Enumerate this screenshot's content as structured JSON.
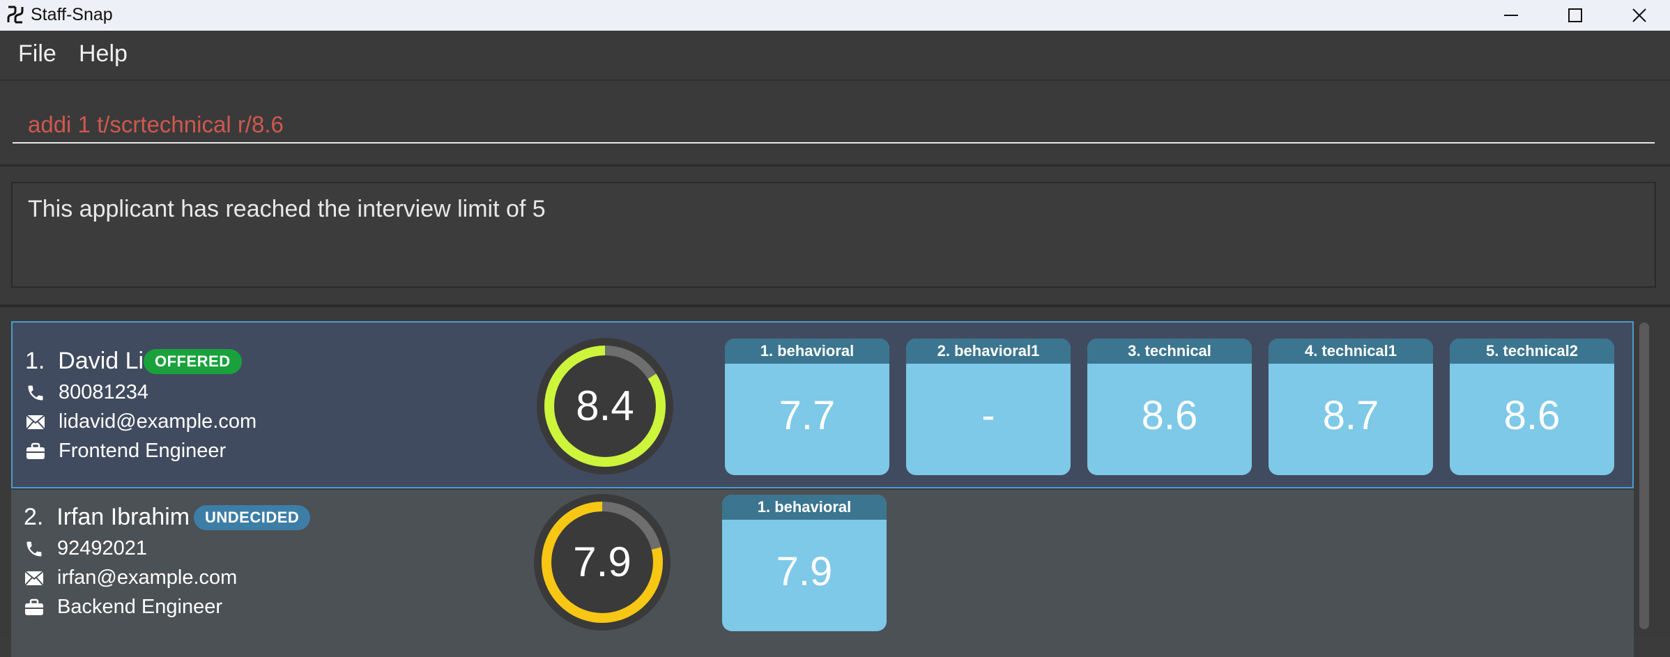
{
  "window": {
    "title": "Staff-Snap"
  },
  "menu": {
    "file": "File",
    "help": "Help"
  },
  "command": {
    "value": "addi 1 t/scrtechnical r/8.6"
  },
  "result": {
    "text": "This applicant has reached the interview limit of 5"
  },
  "applicants": [
    {
      "index": "1.",
      "name": "David Li",
      "status": "OFFERED",
      "phone": "80081234",
      "email": "lidavid@example.com",
      "position": "Frontend Engineer",
      "rating": "8.4",
      "rating_fraction": 0.84,
      "ring_color": "#cdf53b",
      "interviews": [
        {
          "label": "1. behavioral",
          "score": "7.7"
        },
        {
          "label": "2. behavioral1",
          "score": "-"
        },
        {
          "label": "3. technical",
          "score": "8.6"
        },
        {
          "label": "4. technical1",
          "score": "8.7"
        },
        {
          "label": "5. technical2",
          "score": "8.6"
        }
      ]
    },
    {
      "index": "2.",
      "name": "Irfan Ibrahim",
      "status": "UNDECIDED",
      "phone": "92492021",
      "email": "irfan@example.com",
      "position": "Backend Engineer",
      "rating": "7.9",
      "rating_fraction": 0.79,
      "ring_color": "#f7c713",
      "interviews": [
        {
          "label": "1. behavioral",
          "score": "7.9"
        }
      ]
    }
  ],
  "icons": {
    "phone": "phone-icon",
    "email": "envelope-icon",
    "position": "briefcase-icon"
  },
  "colors": {
    "offered": "#19a23c",
    "undecided": "#3d7ea7",
    "selected_border": "#4b9bcc",
    "command_text": "#d0584e"
  }
}
